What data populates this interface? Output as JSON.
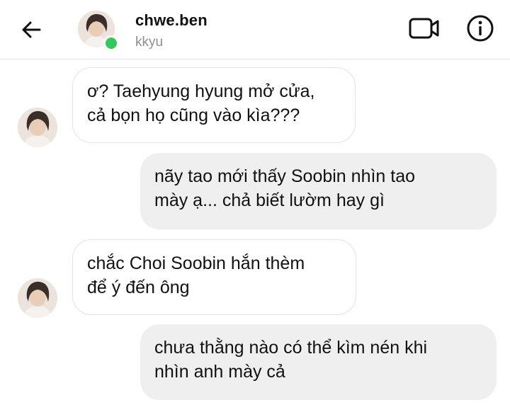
{
  "header": {
    "username": "chwe.ben",
    "subtitle": "kkyu",
    "online_color": "#34c759",
    "back_icon": "arrow-left-icon",
    "video_icon": "video-camera-icon",
    "info_icon": "info-circle-icon"
  },
  "messages": [
    {
      "direction": "incoming",
      "text": "ơ? Taehyung hyung mở cửa,\ncả bọn họ cũng vào kìa???"
    },
    {
      "direction": "outgoing",
      "text": "nãy tao mới thấy Soobin nhìn tao\nmày ạ... chả biết lườm hay gì"
    },
    {
      "direction": "incoming",
      "text": "chắc Choi Soobin hắn thèm\nđể ý đến ông"
    },
    {
      "direction": "outgoing",
      "text": "chưa thằng nào có thể kìm nén khi\nnhìn anh mày cả"
    }
  ],
  "colors": {
    "incoming_bubble": "#ffffff",
    "outgoing_bubble": "#efefef",
    "divider": "#e6e6e6"
  }
}
